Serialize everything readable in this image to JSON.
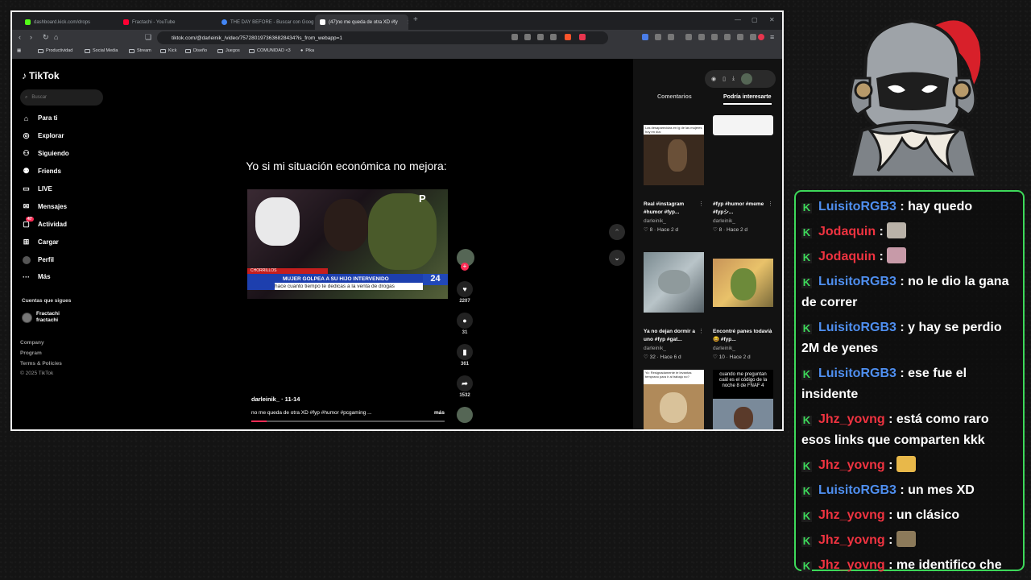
{
  "browser": {
    "tabs": [
      {
        "label": "dashboard.kick.com/drops",
        "fav": "#53fc18"
      },
      {
        "label": "Fractachi - YouTube",
        "fav": "#ff0033"
      },
      {
        "label": "THE DAY BEFORE - Buscar con Goog",
        "fav": "#4285f4"
      },
      {
        "label": "(47)no me queda de otra XD #fy",
        "fav": "#ffffff"
      }
    ],
    "url": "tiktok.com/@darleinik_/video/7572801973636828434?is_from_webapp=1",
    "bookmarks": [
      "Productividad",
      "Social Media",
      "Stream",
      "Kick",
      "Diseño",
      "Juegos",
      "COMUNIDAD <3",
      "Pika"
    ]
  },
  "tiktok": {
    "logo": "TikTok",
    "search_placeholder": "Buscar",
    "nav": [
      {
        "label": "Para ti",
        "icon": "home-icon"
      },
      {
        "label": "Explorar",
        "icon": "compass-icon"
      },
      {
        "label": "Siguiendo",
        "icon": "following-icon"
      },
      {
        "label": "Friends",
        "icon": "friends-icon"
      },
      {
        "label": "LIVE",
        "icon": "live-icon"
      },
      {
        "label": "Mensajes",
        "icon": "message-icon"
      },
      {
        "label": "Actividad",
        "icon": "activity-icon",
        "badge": "47"
      },
      {
        "label": "Cargar",
        "icon": "upload-icon"
      },
      {
        "label": "Perfil",
        "icon": "profile-icon"
      },
      {
        "label": "Más",
        "icon": "more-icon"
      }
    ],
    "following_header": "Cuentas que sigues",
    "following_account": {
      "name": "Fractachi",
      "handle": "fractachi"
    },
    "footer": [
      "Company",
      "Program",
      "Terms & Policies",
      "© 2025 TikTok"
    ],
    "video": {
      "caption": "Yo si mi situación económica no mejora:",
      "news_region": "CHORRILLOS",
      "news_headline": "MUJER GOLPEA A SU HIJO INTERVENIDO",
      "news_sub": "hace cuanto tiempo te dedicas a la venta de drogas",
      "news_channel": "24",
      "author": "darleinik_ · 11-14",
      "description": "no me queda de otra XD #fyp #humor #pcgaming ...",
      "more": "más",
      "likes": "2207",
      "comments": "31",
      "saves": "361",
      "shares": "1532",
      "progress": 0.08
    },
    "panel_tabs": [
      "Comentarios",
      "Podría interesarte"
    ],
    "suggestions": [
      {
        "title": "Real #instagram #humor #fyp...",
        "user": "darleinik_",
        "meta": "♡ 8 · Hace 2 d",
        "thumb_text": "Las desaparecidas en ig de las mujeres hoy en día:"
      },
      {
        "title": "#fyp #humor #meme #fypシ...",
        "user": "darleinik_",
        "meta": "♡ 8 · Hace 2 d",
        "thumb_text": ""
      },
      {
        "title": "Ya no dejan dormir a uno #fyp #gat...",
        "user": "darleinik_",
        "meta": "♡ 32 · Hace 6 d",
        "thumb_text": ""
      },
      {
        "title": "Encontré panes todavía 😆 #fyp...",
        "user": "darleinik_",
        "meta": "♡ 10 · Hace 2 d",
        "thumb_text": ""
      },
      {
        "title": "",
        "user": "",
        "meta": "",
        "thumb_text": "Yo: Resignadamente te levantas temprano para ir al trabajo no?"
      },
      {
        "title": "",
        "user": "",
        "meta": "",
        "thumb_text": "cuando me preguntan cuál es el código de la noche 8 de FNAF 4"
      }
    ]
  },
  "chat": {
    "messages": [
      {
        "user": "LuisitoRGB3",
        "color": "#4f8ff0",
        "text": "hay quedo"
      },
      {
        "user": "Jodaquin",
        "color": "#ef3340",
        "text": "",
        "emote": "#b9b2a8"
      },
      {
        "user": "Jodaquin",
        "color": "#ef3340",
        "text": "",
        "emote": "#c79aa8"
      },
      {
        "user": "LuisitoRGB3",
        "color": "#4f8ff0",
        "text": "no le dio la gana de correr"
      },
      {
        "user": "LuisitoRGB3",
        "color": "#4f8ff0",
        "text": "y hay se perdio 2M de yenes"
      },
      {
        "user": "LuisitoRGB3",
        "color": "#4f8ff0",
        "text": "ese fue el insidente"
      },
      {
        "user": "Jhz_yovng",
        "color": "#ef3340",
        "text": "está como raro esos links que comparten kkk"
      },
      {
        "user": "Jhz_yovng",
        "color": "#ef3340",
        "text": "",
        "emote": "#e8b84a"
      },
      {
        "user": "LuisitoRGB3",
        "color": "#4f8ff0",
        "text": "un mes XD"
      },
      {
        "user": "Jhz_yovng",
        "color": "#ef3340",
        "text": "un clásico"
      },
      {
        "user": "Jhz_yovng",
        "color": "#ef3340",
        "text": "",
        "emote": "#8c7a5a"
      },
      {
        "user": "Jhz_yovng",
        "color": "#ef3340",
        "text": "me identifico che"
      }
    ]
  }
}
